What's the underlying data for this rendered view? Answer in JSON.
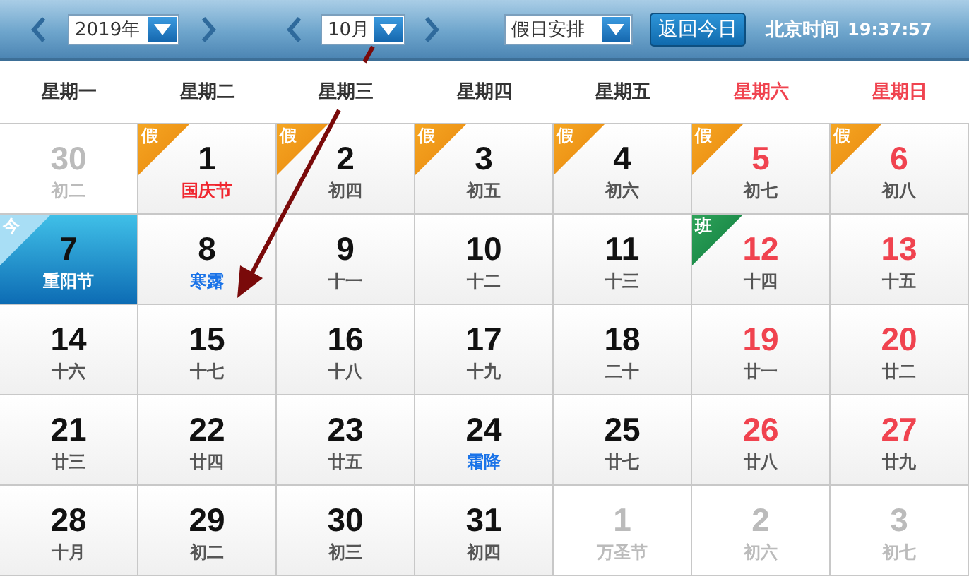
{
  "toolbar": {
    "year": "2019年",
    "month": "10月",
    "mode": "假日安排",
    "today_button": "返回今日",
    "clock_label": "北京时间",
    "clock_time": "19:37:57"
  },
  "weekdays": [
    {
      "label": "星期一",
      "weekend": false
    },
    {
      "label": "星期二",
      "weekend": false
    },
    {
      "label": "星期三",
      "weekend": false
    },
    {
      "label": "星期四",
      "weekend": false
    },
    {
      "label": "星期五",
      "weekend": false
    },
    {
      "label": "星期六",
      "weekend": true
    },
    {
      "label": "星期日",
      "weekend": true
    }
  ],
  "days": [
    {
      "day": "30",
      "sub": "初二",
      "muted": true,
      "today": false
    },
    {
      "day": "1",
      "sub": "国庆节",
      "muted": false,
      "weekend": false,
      "today": false,
      "festival": true,
      "solar_term": false,
      "badge": {
        "text": "假",
        "kind": "holiday"
      }
    },
    {
      "day": "2",
      "sub": "初四",
      "muted": false,
      "weekend": false,
      "today": false,
      "festival": false,
      "solar_term": false,
      "badge": {
        "text": "假",
        "kind": "holiday"
      }
    },
    {
      "day": "3",
      "sub": "初五",
      "muted": false,
      "weekend": false,
      "today": false,
      "festival": false,
      "solar_term": false,
      "badge": {
        "text": "假",
        "kind": "holiday"
      }
    },
    {
      "day": "4",
      "sub": "初六",
      "muted": false,
      "weekend": false,
      "today": false,
      "festival": false,
      "solar_term": false,
      "badge": {
        "text": "假",
        "kind": "holiday"
      }
    },
    {
      "day": "5",
      "sub": "初七",
      "muted": false,
      "weekend": true,
      "today": false,
      "festival": false,
      "solar_term": false,
      "badge": {
        "text": "假",
        "kind": "holiday"
      }
    },
    {
      "day": "6",
      "sub": "初八",
      "muted": false,
      "weekend": true,
      "today": false,
      "festival": false,
      "solar_term": false,
      "badge": {
        "text": "假",
        "kind": "holiday"
      }
    },
    {
      "day": "7",
      "sub": "重阳节",
      "muted": false,
      "today": true,
      "badge": {
        "text": "今",
        "kind": "today"
      }
    },
    {
      "day": "8",
      "sub": "寒露",
      "muted": false,
      "weekend": false,
      "today": false,
      "festival": false,
      "solar_term": true
    },
    {
      "day": "9",
      "sub": "十一",
      "muted": false,
      "weekend": false,
      "today": false,
      "festival": false,
      "solar_term": false
    },
    {
      "day": "10",
      "sub": "十二",
      "muted": false,
      "weekend": false,
      "today": false,
      "festival": false,
      "solar_term": false
    },
    {
      "day": "11",
      "sub": "十三",
      "muted": false,
      "weekend": false,
      "today": false,
      "festival": false,
      "solar_term": false
    },
    {
      "day": "12",
      "sub": "十四",
      "muted": false,
      "weekend": true,
      "today": false,
      "festival": false,
      "solar_term": false,
      "badge": {
        "text": "班",
        "kind": "workday"
      }
    },
    {
      "day": "13",
      "sub": "十五",
      "muted": false,
      "weekend": true,
      "today": false,
      "festival": false,
      "solar_term": false
    },
    {
      "day": "14",
      "sub": "十六",
      "muted": false,
      "weekend": false,
      "today": false,
      "festival": false,
      "solar_term": false
    },
    {
      "day": "15",
      "sub": "十七",
      "muted": false,
      "weekend": false,
      "today": false,
      "festival": false,
      "solar_term": false
    },
    {
      "day": "16",
      "sub": "十八",
      "muted": false,
      "weekend": false,
      "today": false,
      "festival": false,
      "solar_term": false
    },
    {
      "day": "17",
      "sub": "十九",
      "muted": false,
      "weekend": false,
      "today": false,
      "festival": false,
      "solar_term": false
    },
    {
      "day": "18",
      "sub": "二十",
      "muted": false,
      "weekend": false,
      "today": false,
      "festival": false,
      "solar_term": false
    },
    {
      "day": "19",
      "sub": "廿一",
      "muted": false,
      "weekend": true,
      "today": false,
      "festival": false,
      "solar_term": false
    },
    {
      "day": "20",
      "sub": "廿二",
      "muted": false,
      "weekend": true,
      "today": false,
      "festival": false,
      "solar_term": false
    },
    {
      "day": "21",
      "sub": "廿三",
      "muted": false,
      "weekend": false,
      "today": false,
      "festival": false,
      "solar_term": false
    },
    {
      "day": "22",
      "sub": "廿四",
      "muted": false,
      "weekend": false,
      "today": false,
      "festival": false,
      "solar_term": false
    },
    {
      "day": "23",
      "sub": "廿五",
      "muted": false,
      "weekend": false,
      "today": false,
      "festival": false,
      "solar_term": false
    },
    {
      "day": "24",
      "sub": "霜降",
      "muted": false,
      "weekend": false,
      "today": false,
      "festival": false,
      "solar_term": true
    },
    {
      "day": "25",
      "sub": "廿七",
      "muted": false,
      "weekend": false,
      "today": false,
      "festival": false,
      "solar_term": false
    },
    {
      "day": "26",
      "sub": "廿八",
      "muted": false,
      "weekend": true,
      "today": false,
      "festival": false,
      "solar_term": false
    },
    {
      "day": "27",
      "sub": "廿九",
      "muted": false,
      "weekend": true,
      "today": false,
      "festival": false,
      "solar_term": false
    },
    {
      "day": "28",
      "sub": "十月",
      "muted": false,
      "weekend": false,
      "today": false,
      "festival": false,
      "solar_term": false
    },
    {
      "day": "29",
      "sub": "初二",
      "muted": false,
      "weekend": false,
      "today": false,
      "festival": false,
      "solar_term": false
    },
    {
      "day": "30",
      "sub": "初三",
      "muted": false,
      "weekend": false,
      "today": false,
      "festival": false,
      "solar_term": false
    },
    {
      "day": "31",
      "sub": "初四",
      "muted": false,
      "weekend": false,
      "today": false,
      "festival": false,
      "solar_term": false
    },
    {
      "day": "1",
      "sub": "万圣节",
      "muted": true,
      "today": false
    },
    {
      "day": "2",
      "sub": "初六",
      "muted": true,
      "today": false
    },
    {
      "day": "3",
      "sub": "初七",
      "muted": true,
      "today": false
    }
  ]
}
